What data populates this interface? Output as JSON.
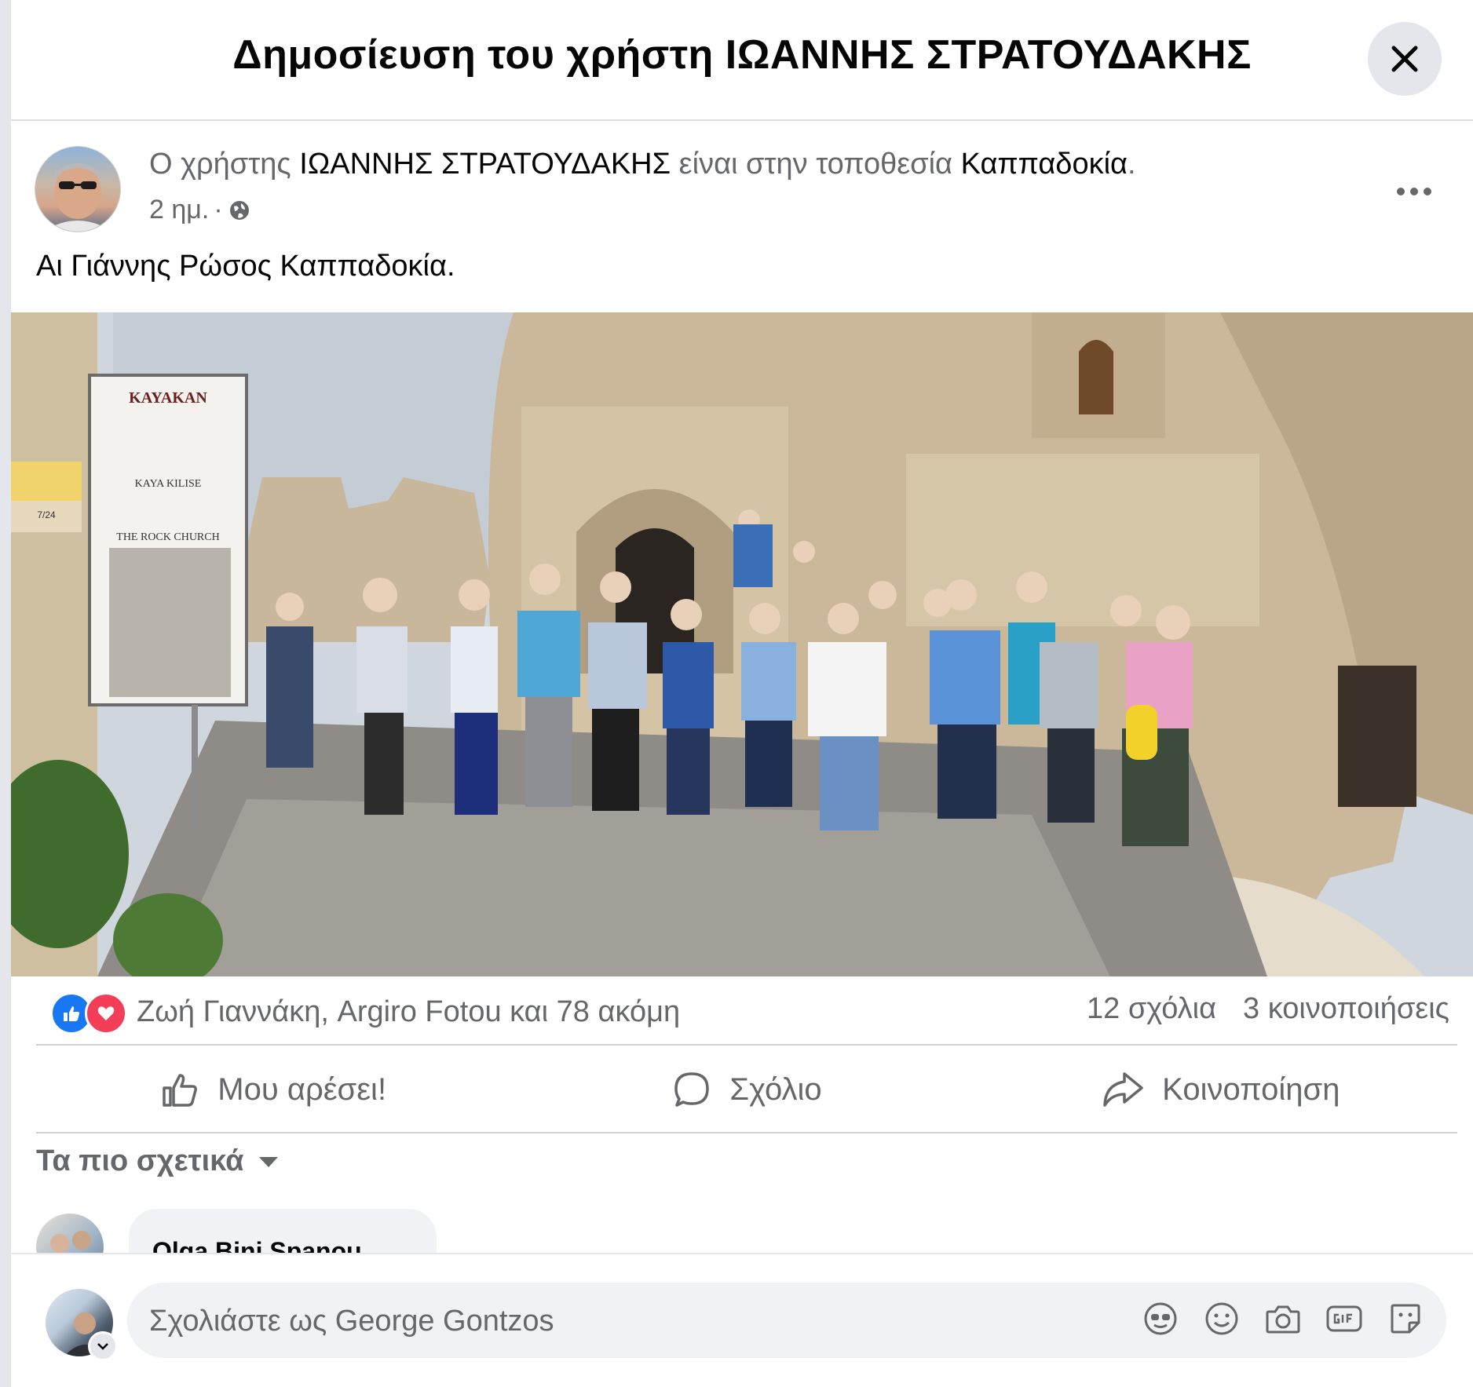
{
  "dialog": {
    "title": "Δημοσίευση του χρήστη ΙΩΑΝΝΗΣ ΣΤΡΑΤΟΥΔΑΚΗΣ"
  },
  "post": {
    "prefix": "Ο χρήστης ",
    "author": "ΙΩΑΝΝΗΣ ΣΤΡΑΤΟΥΔΑΚΗΣ",
    "location_prefix": " είναι στην τοποθεσία ",
    "location": "Καππαδοκία",
    "period": ".",
    "time": "2 ημ.",
    "dot": "·",
    "text": "Αι Γιάννης Ρώσος Καππαδοκία.",
    "photo": {
      "sign_brand": "KAYAKAN",
      "sign_title": "KAYA KILISE",
      "sign_subtitle": "THE ROCK CHURCH",
      "sign_number": "7/24"
    }
  },
  "stats": {
    "reactions_text": "Ζωή Γιαννάκη, Argiro Fotou και 78 ακόμη",
    "comments": "12 σχόλια",
    "shares": "3 κοινοποιήσεις"
  },
  "actions": {
    "like": "Μου αρέσει!",
    "comment": "Σχόλιο",
    "share": "Κοινοποίηση"
  },
  "comments": {
    "sort_label": "Τα πιο σχετικά",
    "first_author": "Olga Bini Spanou"
  },
  "composer": {
    "placeholder": "Σχολιάστε ως George Gontzos"
  },
  "colors": {
    "like_blue": "#1877f2",
    "love_red": "#f33e58",
    "secondary_text": "#65676b"
  }
}
